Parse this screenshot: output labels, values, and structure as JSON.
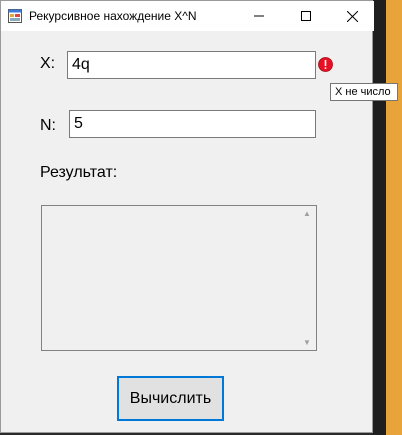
{
  "window": {
    "title": "Рекурсивное нахождение X^N",
    "controls": {
      "minimize": "─",
      "maximize": "☐",
      "close": "✕"
    }
  },
  "form": {
    "x_label": "X:",
    "x_value": "4q",
    "n_label": "N:",
    "n_value": "5",
    "result_label": "Результат:",
    "result_value": "",
    "calculate_label": "Вычислить"
  },
  "validation": {
    "error_tooltip": "X не число",
    "error_color": "#e81123"
  },
  "colors": {
    "accent": "#0078d7",
    "window_bg": "#f0f0f0",
    "taskbar_orange": "#e8a33a"
  }
}
